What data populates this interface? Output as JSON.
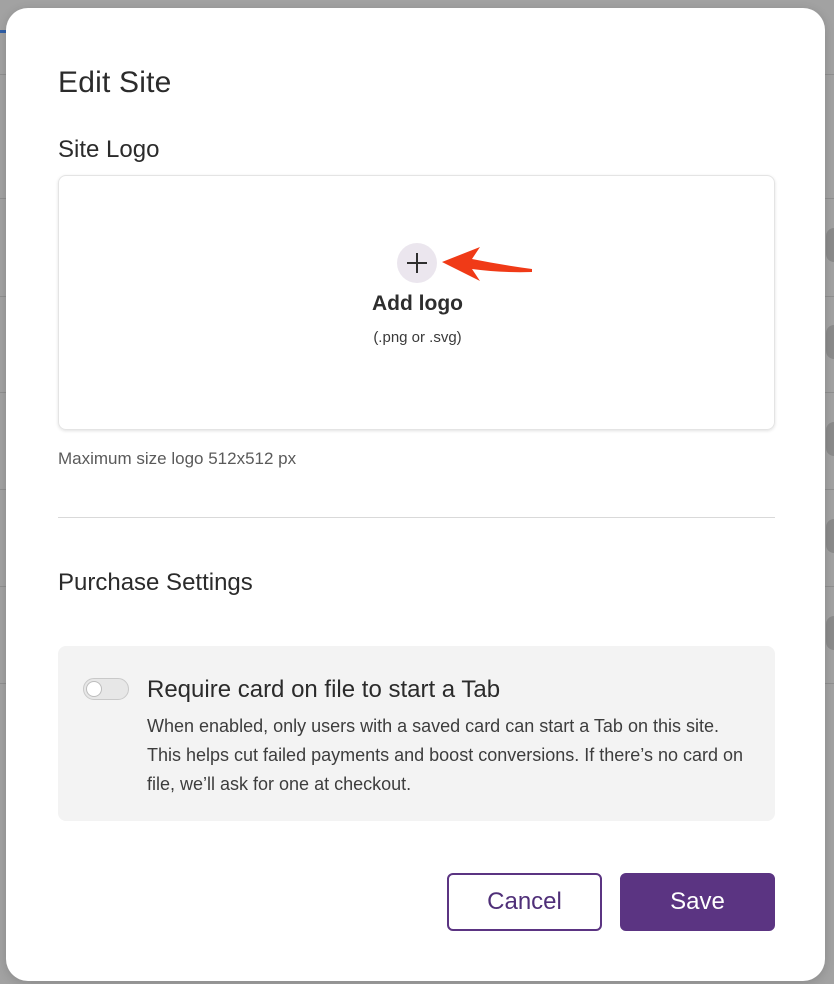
{
  "modal": {
    "title": "Edit Site"
  },
  "site_logo": {
    "section_title": "Site Logo",
    "add_icon": "plus-icon",
    "add_label": "Add logo",
    "formats": "(.png or .svg)",
    "hint": "Maximum size logo 512x512 px",
    "annotation_icon": "red-arrow-icon",
    "annotation_color": "#f03a17"
  },
  "purchase_settings": {
    "section_title": "Purchase Settings",
    "require_card": {
      "title": "Require card on file to start a Tab",
      "description": "When enabled, only users with a saved card can start a Tab on this site. This helps cut failed payments and boost conversions. If there’s no card on file, we’ll ask for one at checkout.",
      "enabled": false
    }
  },
  "actions": {
    "cancel_label": "Cancel",
    "save_label": "Save"
  },
  "colors": {
    "primary": "#5b3482",
    "plus_bg": "#ebe6ee",
    "card_bg": "#f3f3f3"
  }
}
